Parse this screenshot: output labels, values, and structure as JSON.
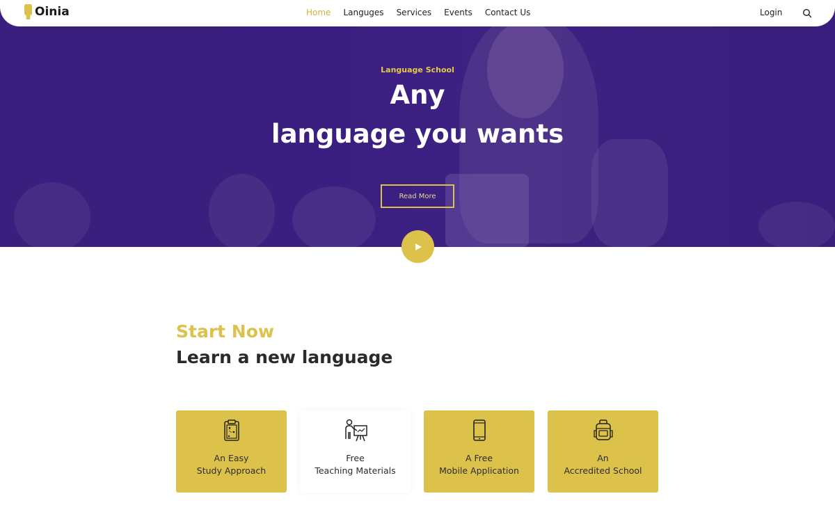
{
  "brand": {
    "name": "Oinia",
    "accent": "#dcc24b",
    "hero_color": "#3a1f7e"
  },
  "nav": {
    "items": [
      {
        "label": "Home",
        "active": true
      },
      {
        "label": "Languges",
        "active": false
      },
      {
        "label": "Services",
        "active": false
      },
      {
        "label": "Events",
        "active": false
      },
      {
        "label": "Contact Us",
        "active": false
      }
    ],
    "login_label": "Login",
    "search_icon": "search-icon"
  },
  "hero": {
    "eyebrow": "Language School",
    "title_line1": "Any",
    "title_line2": "language you wants",
    "cta_label": "Read More",
    "play_icon": "play-icon"
  },
  "intro": {
    "kicker": "Start Now",
    "heading": "Learn a new language"
  },
  "features": [
    {
      "line1": "An Easy",
      "line2": "Study Approach",
      "icon": "clipboard-icon",
      "style": "yellow"
    },
    {
      "line1": "Free",
      "line2": "Teaching Materials",
      "icon": "teacher-icon",
      "style": "white"
    },
    {
      "line1": "A Free",
      "line2": "Mobile Application",
      "icon": "smartphone-icon",
      "style": "yellow"
    },
    {
      "line1": "An",
      "line2": "Accredited School",
      "icon": "backpack-icon",
      "style": "yellow"
    }
  ]
}
